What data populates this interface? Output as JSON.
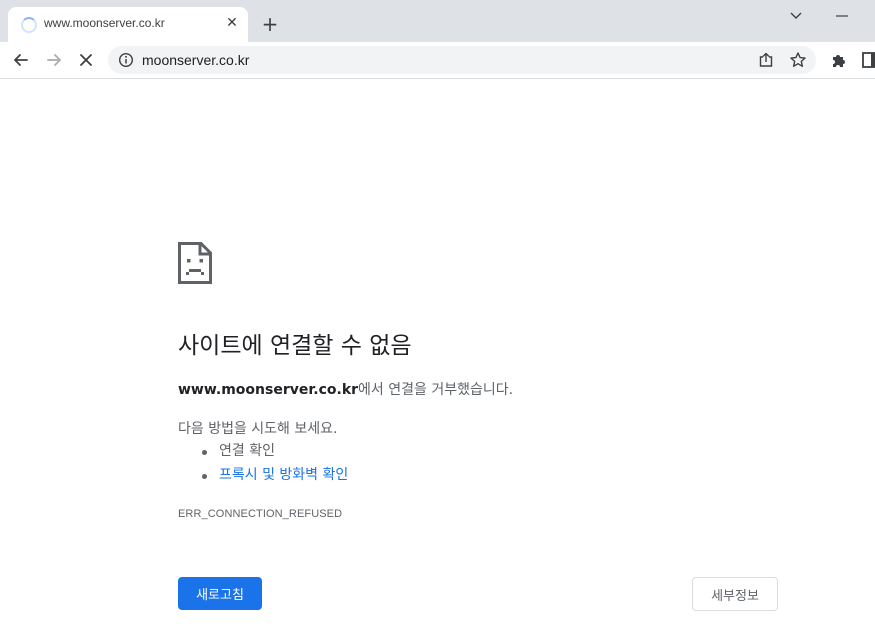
{
  "tab": {
    "title": "www.moonserver.co.kr",
    "close_glyph": "✕",
    "new_tab_glyph": "+"
  },
  "omnibox": {
    "url": "moonserver.co.kr"
  },
  "icons": {
    "tab_loading": "loading-spinner-icon",
    "back": "arrow-left-icon",
    "forward": "arrow-right-icon",
    "stop": "close-icon",
    "site_info": "info-circle-icon",
    "share": "share-icon",
    "bookmark": "star-icon",
    "extensions": "puzzle-icon",
    "side_panel": "side-panel-icon",
    "tab_search": "chevron-down-icon",
    "minimize": "minimize-icon",
    "error": "sad-document-icon"
  },
  "error": {
    "heading": "사이트에 연결할 수 없음",
    "host": "www.moonserver.co.kr",
    "message_suffix": "에서 연결을 거부했습니다.",
    "try_label": "다음 방법을 시도해 보세요.",
    "suggestions": [
      "연결 확인",
      "프록시 및 방화벽 확인"
    ],
    "code": "ERR_CONNECTION_REFUSED"
  },
  "buttons": {
    "reload": "새로고침",
    "details": "세부정보"
  },
  "colors": {
    "tabstrip_bg": "#dee1e6",
    "primary_button": "#1a73e8",
    "link": "#1a73e8",
    "text_primary": "#202124",
    "text_secondary": "#5f6368"
  }
}
